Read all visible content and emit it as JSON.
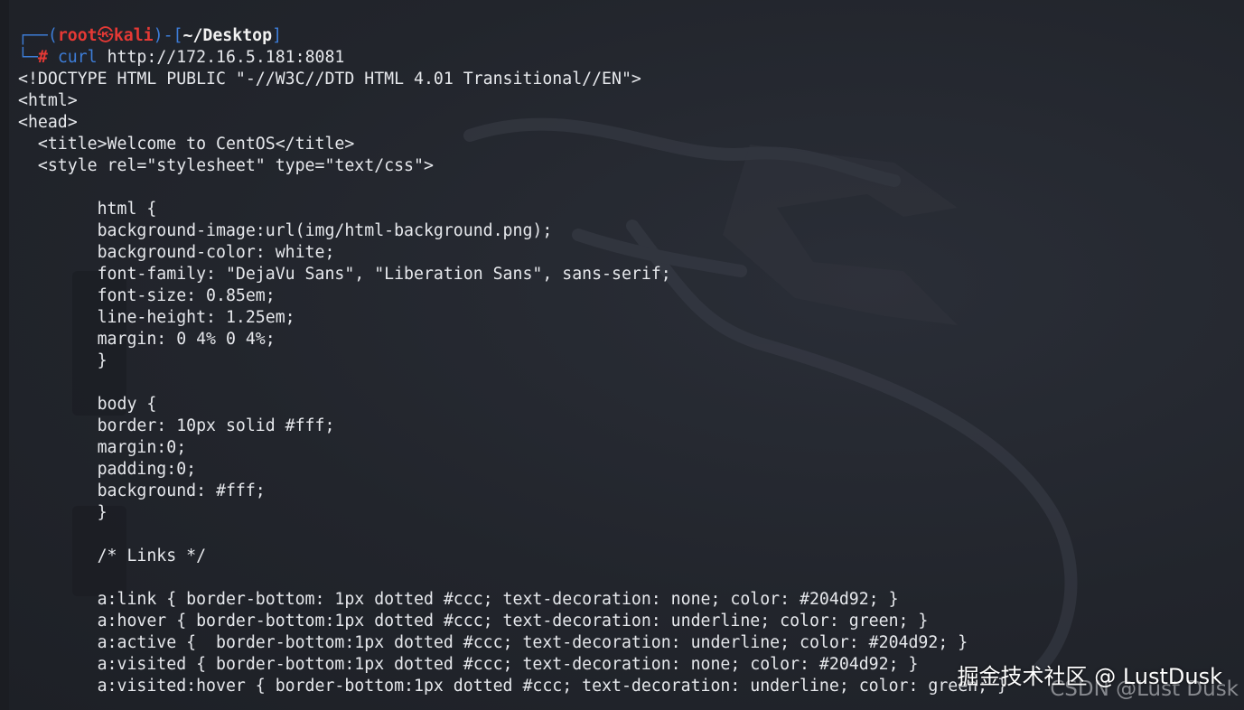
{
  "window": {
    "background": "#23262e"
  },
  "prompt": {
    "open_paren": "┌──(",
    "user": "root",
    "skull_icon": "㉿",
    "host": "kali",
    "mid": ")-[",
    "path": "~/Desktop",
    "close_bracket": "]",
    "bottom_prefix": "└─",
    "hash": "#",
    "command": "curl",
    "argument": "http://172.16.5.181:8081",
    "colors": {
      "user": "#e53935",
      "frame": "#3d7dd8",
      "path": "#f2f2f2"
    }
  },
  "output_lines": [
    "<!DOCTYPE HTML PUBLIC \"-//W3C//DTD HTML 4.01 Transitional//EN\">",
    "<html>",
    "<head>",
    "  <title>Welcome to CentOS</title>",
    "  <style rel=\"stylesheet\" type=\"text/css\">",
    "",
    "        html {",
    "        background-image:url(img/html-background.png);",
    "        background-color: white;",
    "        font-family: \"DejaVu Sans\", \"Liberation Sans\", sans-serif;",
    "        font-size: 0.85em;",
    "        line-height: 1.25em;",
    "        margin: 0 4% 0 4%;",
    "        }",
    "",
    "        body {",
    "        border: 10px solid #fff;",
    "        margin:0;",
    "        padding:0;",
    "        background: #fff;",
    "        }",
    "",
    "        /* Links */",
    "",
    "        a:link { border-bottom: 1px dotted #ccc; text-decoration: none; color: #204d92; }",
    "        a:hover { border-bottom:1px dotted #ccc; text-decoration: underline; color: green; }",
    "        a:active {  border-bottom:1px dotted #ccc; text-decoration: underline; color: #204d92; }",
    "        a:visited { border-bottom:1px dotted #ccc; text-decoration: none; color: #204d92; }",
    "        a:visited:hover { border-bottom:1px dotted #ccc; text-decoration: underline; color: green; }"
  ],
  "watermark": {
    "primary": "掘金技术社区 @ LustDusk",
    "secondary": "CSDN @Lust Dusk"
  }
}
